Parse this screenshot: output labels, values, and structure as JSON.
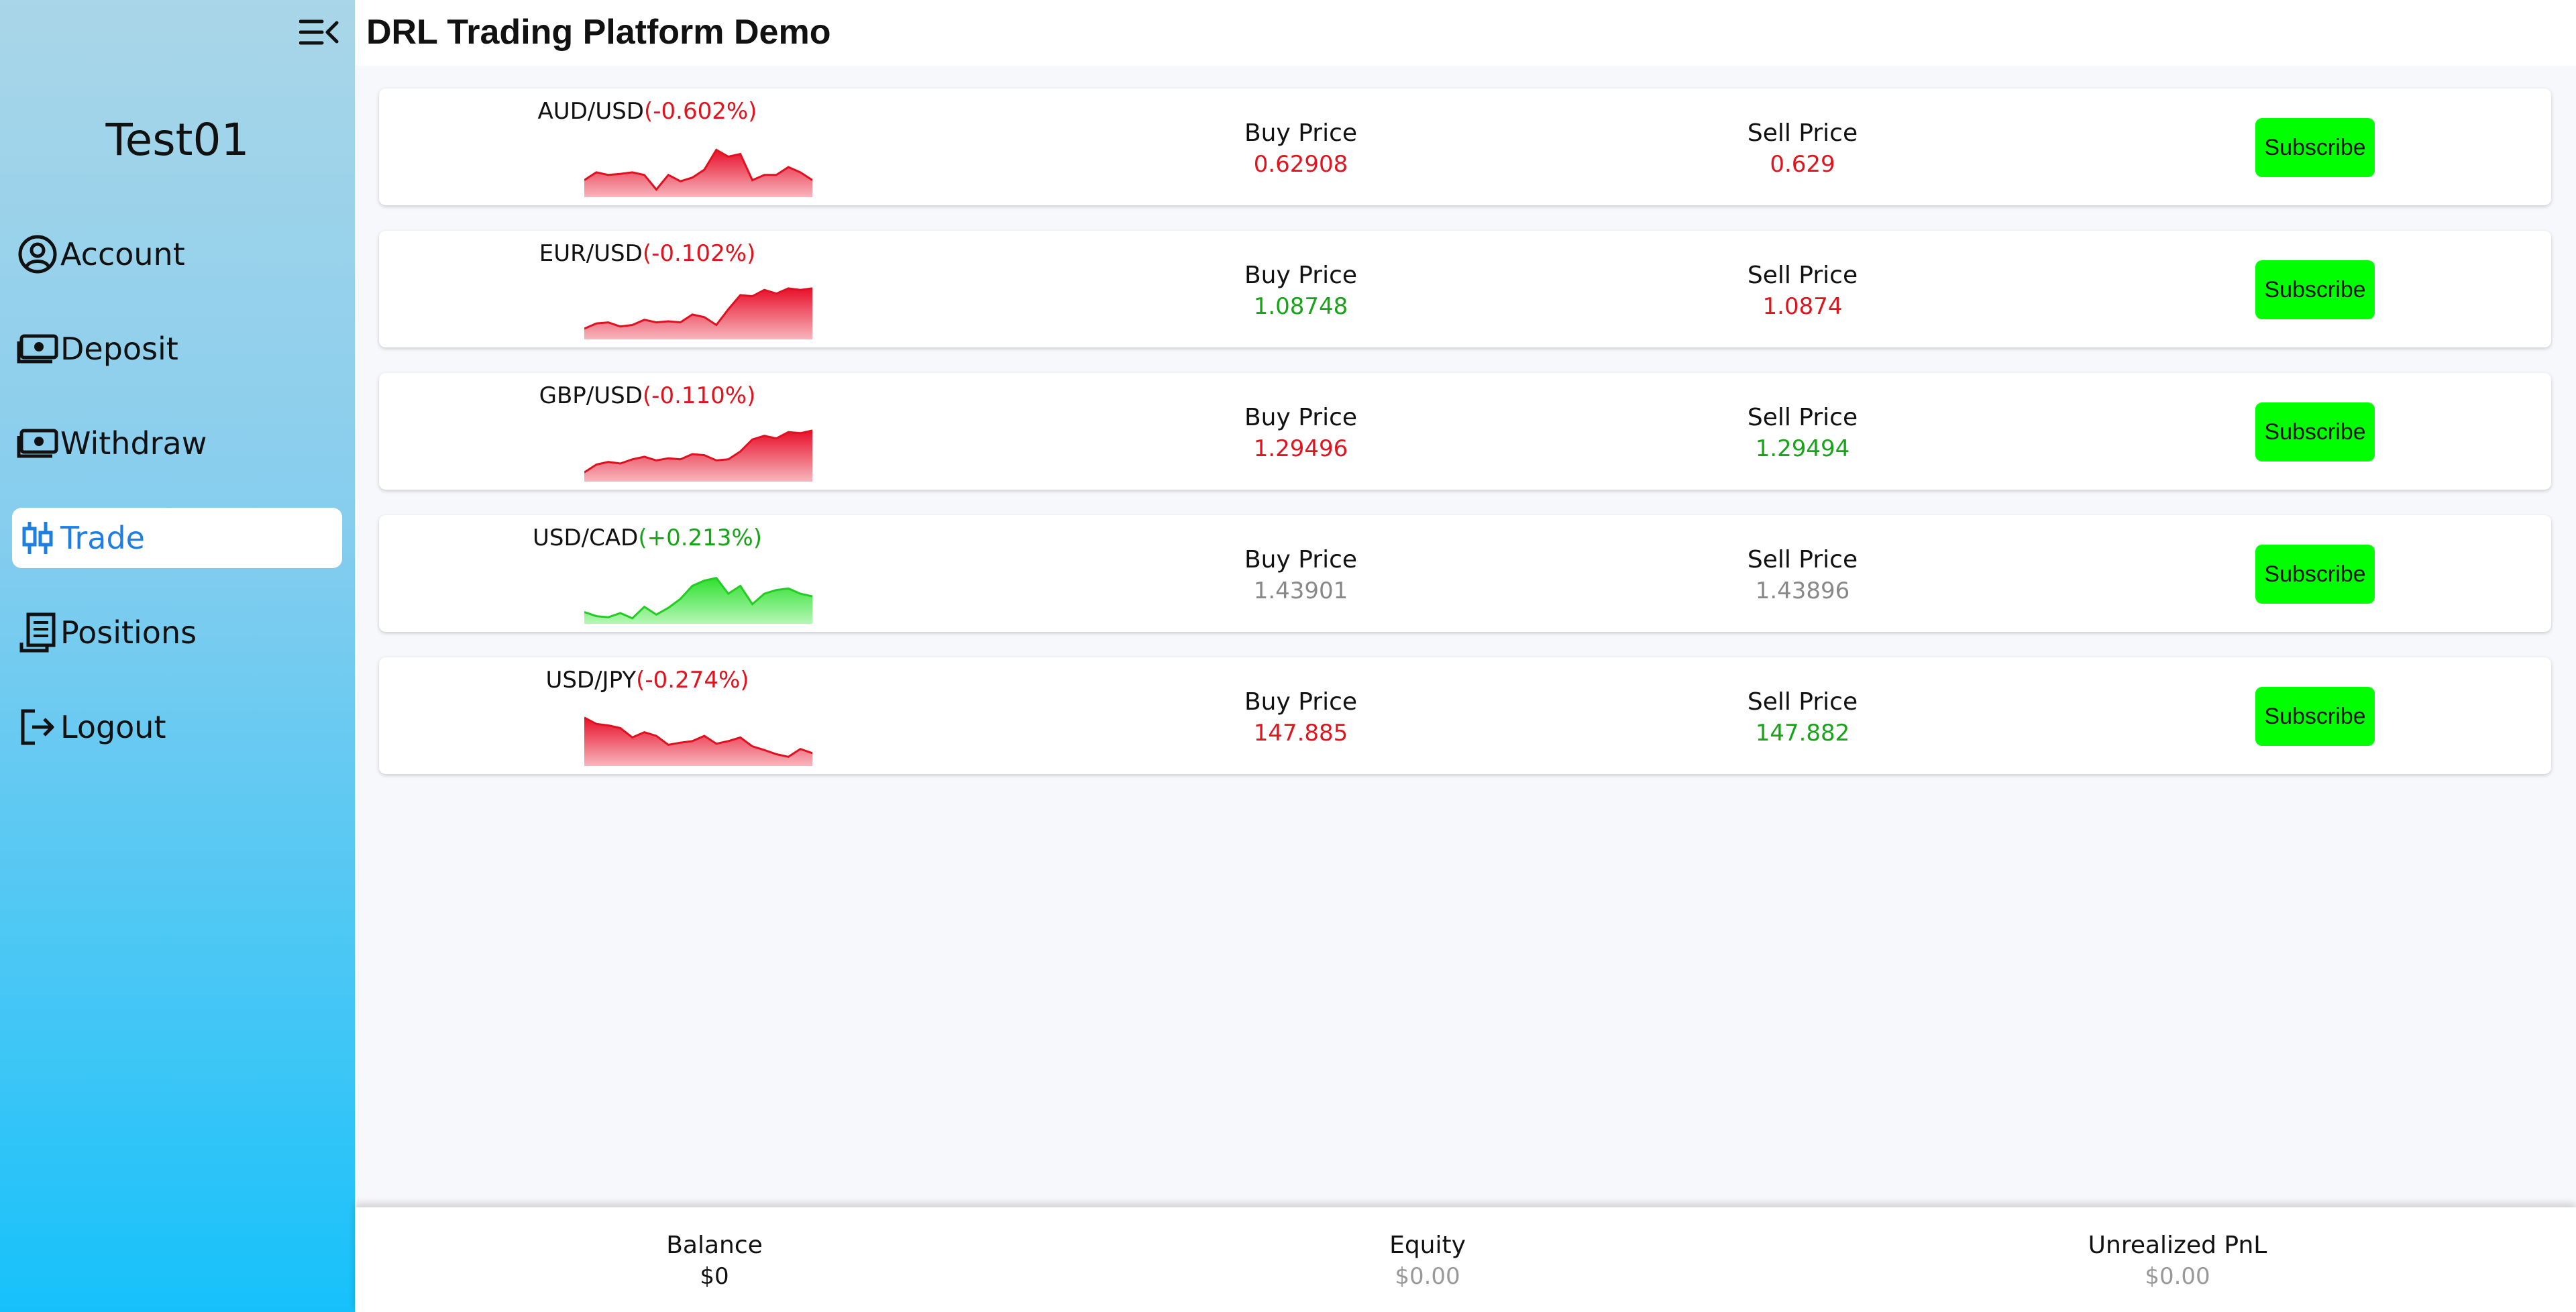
{
  "app": {
    "title": "DRL Trading Platform Demo"
  },
  "sidebar": {
    "user": "Test01",
    "items": [
      {
        "label": "Account",
        "icon": "user-circle-icon"
      },
      {
        "label": "Deposit",
        "icon": "money-icon"
      },
      {
        "label": "Withdraw",
        "icon": "money-icon"
      },
      {
        "label": "Trade",
        "icon": "candlestick-icon",
        "active": true
      },
      {
        "label": "Positions",
        "icon": "receipt-icon"
      },
      {
        "label": "Logout",
        "icon": "logout-icon"
      }
    ]
  },
  "trade": {
    "buy_header": "Buy Price",
    "sell_header": "Sell Price",
    "subscribe_label": "Subscribe",
    "rows": [
      {
        "pair": "AUD/USD",
        "change": "(-0.602%)",
        "direction": "down",
        "buy": "0.62908",
        "buy_color": "red",
        "sell": "0.629",
        "sell_color": "red"
      },
      {
        "pair": "EUR/USD",
        "change": "(-0.102%)",
        "direction": "down",
        "buy": "1.08748",
        "buy_color": "green",
        "sell": "1.0874",
        "sell_color": "red"
      },
      {
        "pair": "GBP/USD",
        "change": "(-0.110%)",
        "direction": "down",
        "buy": "1.29496",
        "buy_color": "red",
        "sell": "1.29494",
        "sell_color": "green"
      },
      {
        "pair": "USD/CAD",
        "change": "(+0.213%)",
        "direction": "up",
        "buy": "1.43901",
        "buy_color": "gray",
        "sell": "1.43896",
        "sell_color": "gray"
      },
      {
        "pair": "USD/JPY",
        "change": "(-0.274%)",
        "direction": "down",
        "buy": "147.885",
        "buy_color": "red",
        "sell": "147.882",
        "sell_color": "green"
      }
    ]
  },
  "footer": {
    "balance_label": "Balance",
    "balance": "$0",
    "equity_label": "Equity",
    "equity": "$0.00",
    "pnl_label": "Unrealized PnL",
    "pnl": "$0.00"
  },
  "colors": {
    "red": "#e0141e",
    "green": "#18a418",
    "subscribe": "#00ff00",
    "active": "#1e7fe0"
  }
}
